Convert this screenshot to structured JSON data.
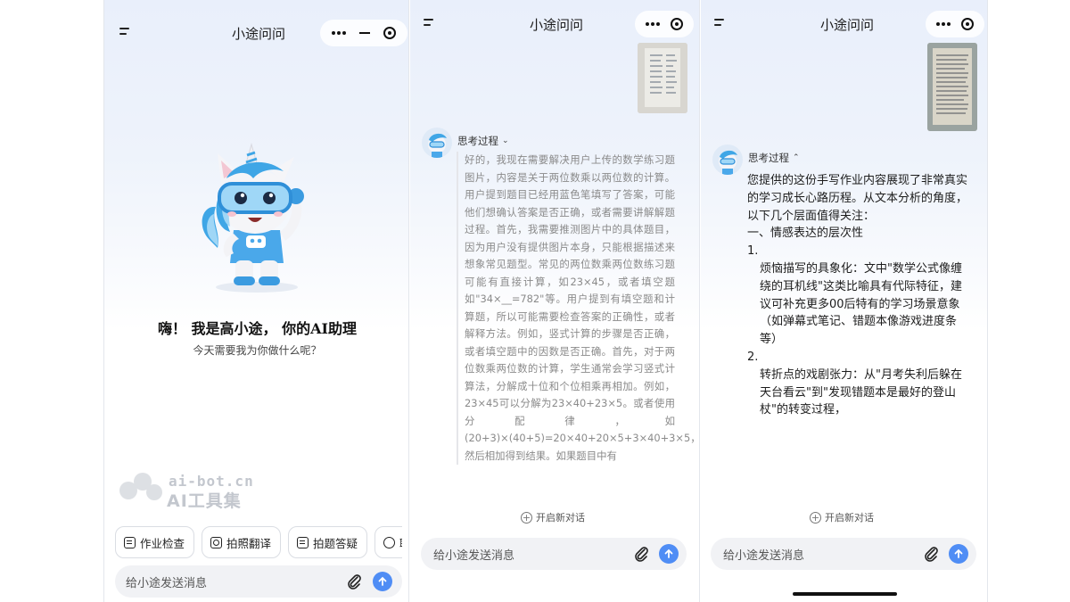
{
  "app": {
    "title": "小途问问"
  },
  "screen1": {
    "greeting_title": "嗨！ 我是高小途， 你的AI助理",
    "greeting_subtitle": "今天需要我为你做什么呢？",
    "watermark_domain": "ai-bot.cn",
    "watermark_name": "AI工具集",
    "chips": [
      {
        "label": "作业检查",
        "icon": "homework-check-icon"
      },
      {
        "label": "拍照翻译",
        "icon": "camera-icon"
      },
      {
        "label": "拍题答疑",
        "icon": "scan-question-icon"
      },
      {
        "label": "聊",
        "icon": "chat-bubble-icon"
      }
    ],
    "input_placeholder": "给小途发送消息"
  },
  "screen2": {
    "thinking_label": "思考过程",
    "thinking_state": "collapsed-chevron-down",
    "reasoning_text": "好的，我现在需要解决用户上传的数学练习题图片，内容是关于两位数乘以两位数的计算。用户提到题目已经用蓝色笔填写了答案，可能他们想确认答案是否正确，或者需要讲解解题过程。首先，我需要推测图片中的具体题目，因为用户没有提供图片本身，只能根据描述来想象常见题型。常见的两位数乘两位数练习题可能有直接计算，如23×45，或者填空题如\"34×__=782\"等。用户提到有填空题和计算题，所以可能需要检查答案的正确性，或者解释方法。例如，竖式计算的步骤是否正确，或者填空题中的因数是否正确。首先，对于两位数乘两位数的计算，学生通常会学习竖式计算法，分解成十位和个位相乘再相加。例如，23×45可以分解为23×40+23×5。或者使用分配律，如(20+3)×(40+5)=20×40+20×5+3×40+3×5，然后相加得到结果。如果题目中有",
    "new_chat_label": "开启新对话",
    "input_placeholder": "给小途发送消息"
  },
  "screen3": {
    "thinking_label": "思考过程",
    "thinking_state": "expanded-chevron-up",
    "answer_intro": "您提供的这份手写作业内容展现了非常真实的学习成长心路历程。从文本分析的角度，以下几个层面值得关注：",
    "section_heading": "一、情感表达的层次性",
    "list_items": [
      {
        "num": "1.",
        "text": "烦恼描写的具象化：文中\"数学公式像缠绕的耳机线\"这类比喻具有代际特征，建议可补充更多00后特有的学习场景意象（如弹幕式笔记、错题本像游戏进度条等）"
      },
      {
        "num": "2.",
        "text": "转折点的戏剧张力：从\"月考失利后躲在天台看云\"到\"发现错题本是最好的登山杖\"的转变过程，"
      }
    ],
    "new_chat_label": "开启新对话",
    "input_placeholder": "给小途发送消息"
  },
  "colors": {
    "accent": "#4f8df5",
    "text": "#1c1c1c",
    "muted": "#8a8a8a",
    "chip_border": "#dadde3"
  }
}
